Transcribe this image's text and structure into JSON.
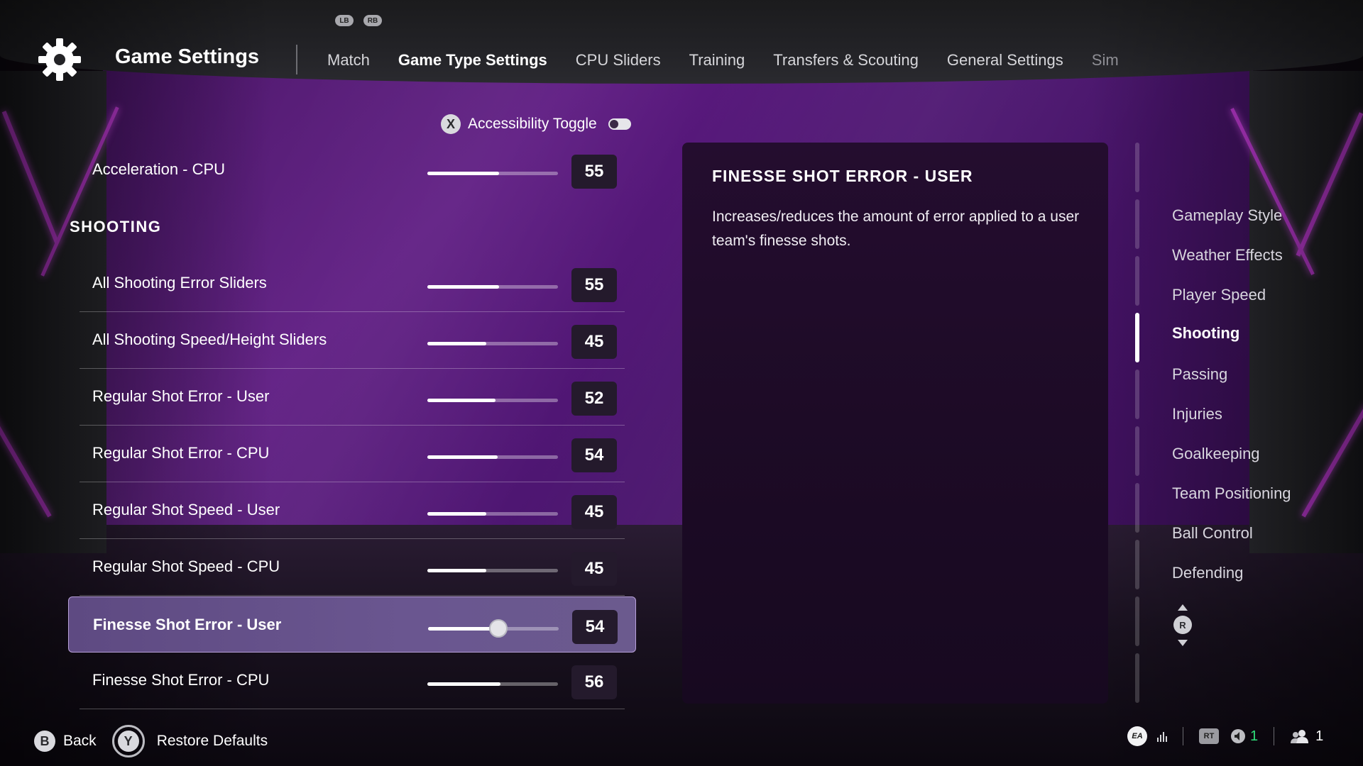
{
  "header": {
    "bumper_left": "LB",
    "bumper_right": "RB",
    "title": "Game Settings",
    "tabs": [
      {
        "label": "Match",
        "state": "normal"
      },
      {
        "label": "Game Type Settings",
        "state": "active"
      },
      {
        "label": "CPU Sliders",
        "state": "normal"
      },
      {
        "label": "Training",
        "state": "normal"
      },
      {
        "label": "Transfers & Scouting",
        "state": "normal"
      },
      {
        "label": "General Settings",
        "state": "normal"
      },
      {
        "label": "Sim",
        "state": "dim"
      }
    ]
  },
  "accessibility": {
    "button": "X",
    "label": "Accessibility Toggle",
    "enabled": false
  },
  "settings": {
    "top_row": {
      "label": "Acceleration - CPU",
      "value": 55
    },
    "section_title": "SHOOTING",
    "rows": [
      {
        "label": "All Shooting Error Sliders",
        "value": 55,
        "selected": false
      },
      {
        "label": "All Shooting Speed/Height Sliders",
        "value": 45,
        "selected": false
      },
      {
        "label": "Regular Shot Error - User",
        "value": 52,
        "selected": false
      },
      {
        "label": "Regular Shot Error - CPU",
        "value": 54,
        "selected": false
      },
      {
        "label": "Regular Shot Speed - User",
        "value": 45,
        "selected": false
      },
      {
        "label": "Regular Shot Speed - CPU",
        "value": 45,
        "selected": false
      },
      {
        "label": "Finesse Shot Error - User",
        "value": 54,
        "selected": true
      },
      {
        "label": "Finesse Shot Error - CPU",
        "value": 56,
        "selected": false
      }
    ],
    "slider_max": 100
  },
  "description": {
    "title": "FINESSE SHOT ERROR - USER",
    "text": "Increases/reduces the amount of error applied to a user team's finesse shots."
  },
  "categories": {
    "items": [
      {
        "label": "Gameplay Style",
        "active": false
      },
      {
        "label": "Weather Effects",
        "active": false
      },
      {
        "label": "Player Speed",
        "active": false
      },
      {
        "label": "Shooting",
        "active": true
      },
      {
        "label": "Passing",
        "active": false
      },
      {
        "label": "Injuries",
        "active": false
      },
      {
        "label": "Goalkeeping",
        "active": false
      },
      {
        "label": "Team Positioning",
        "active": false
      },
      {
        "label": "Ball Control",
        "active": false
      },
      {
        "label": "Defending",
        "active": false
      }
    ],
    "stick_label": "R"
  },
  "footer": {
    "back_button": "B",
    "back_label": "Back",
    "restore_button": "Y",
    "restore_label": "Restore Defaults",
    "ea_label": "EA",
    "rt_label": "RT",
    "voice_count": "1",
    "party_count": "1"
  },
  "colors": {
    "accent_purple": "#5e1b82",
    "neon_pink": "#c13ad6",
    "selected_row": "#6a5690",
    "online_green": "#2fe07a"
  }
}
